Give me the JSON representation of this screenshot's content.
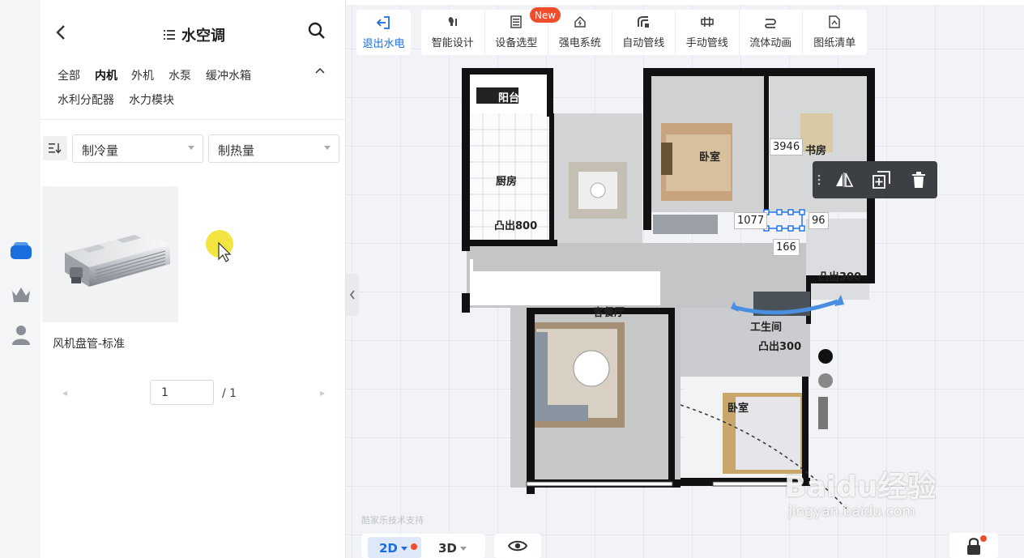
{
  "panel": {
    "title": "水空调",
    "categories": [
      "全部",
      "内机",
      "外机",
      "水泵",
      "缓冲水箱",
      "水利分配器",
      "水力模块"
    ],
    "active_category": "内机",
    "filters": [
      {
        "label": "制冷量"
      },
      {
        "label": "制热量"
      }
    ],
    "product": {
      "name": "风机盘管-标准"
    },
    "pager": {
      "current": "1",
      "total": "/ 1"
    }
  },
  "toolbar": {
    "exit_label": "退出水电",
    "tools": [
      {
        "label": "智能设计",
        "icon": "bulb-icon"
      },
      {
        "label": "设备选型",
        "icon": "list-icon"
      },
      {
        "label": "强电系统",
        "icon": "house-power-icon"
      },
      {
        "label": "自动管线",
        "icon": "auto-pipe-icon"
      },
      {
        "label": "手动管线",
        "icon": "manual-pipe-icon"
      },
      {
        "label": "流体动画",
        "icon": "flow-icon"
      },
      {
        "label": "图纸清单",
        "icon": "drawing-list-icon"
      }
    ],
    "new_badge": "New"
  },
  "floorplan": {
    "rooms": {
      "balcony": "阳台",
      "kitchen": "厨房",
      "bedroom1": "卧室",
      "study": "书房",
      "bay1": "凸出800",
      "bay2": "凸出300",
      "living": "客餐厅",
      "utility": "工生间",
      "bay3": "凸出300",
      "bedroom2": "卧室"
    },
    "dimensions": {
      "d1": "3946",
      "d2": "1077",
      "d3": "96",
      "d4": "166"
    }
  },
  "view": {
    "mode_2d": "2D",
    "mode_3d": "3D"
  },
  "footer": {
    "support_text": "酷家乐技术支持"
  },
  "watermark": {
    "text": "Baidu经验",
    "url": "jingyan.baidu.com"
  },
  "colors": {
    "accent": "#1a6fe0",
    "badge": "#f04d2c",
    "context_menu": "#3c3f44"
  }
}
